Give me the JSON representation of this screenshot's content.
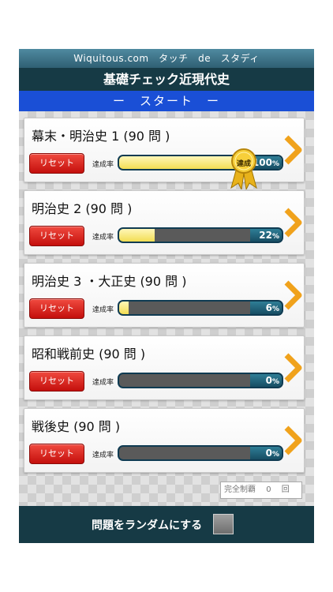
{
  "header": {
    "site": "Wiquitous.com　タッチ　de　スタディ",
    "title": "基礎チェック近現代史"
  },
  "start_label": "ー　スタート　ー",
  "rate_label": "達成率",
  "reset_label": "リセット",
  "percent_unit": "%",
  "medal_label": "達成",
  "items": [
    {
      "title": "幕末・明治史 1 (90 問 )",
      "percent": "100",
      "progress": 1.0
    },
    {
      "title": "明治史 2 (90 問 )",
      "percent": "22",
      "progress": 0.22
    },
    {
      "title": "明治史 3 ・大正史 (90 問 )",
      "percent": "6",
      "progress": 0.06
    },
    {
      "title": "昭和戦前史 (90 問 )",
      "percent": "0",
      "progress": 0.0
    },
    {
      "title": "戦後史 (90 問 )",
      "percent": "0",
      "progress": 0.0
    }
  ],
  "complete_counter": {
    "label": "完全制覇",
    "count": "0",
    "unit": "回"
  },
  "footer": {
    "random_label": "問題をランダムにする",
    "random_checked": false
  },
  "colors": {
    "accent": "#1a4fd6",
    "dark": "#163a45",
    "reset": "#d81f1a",
    "fill": "#f2dd53",
    "chevron": "#f0a21c"
  },
  "icons": {
    "arrow": "chevron-right-icon",
    "medal": "medal-icon"
  }
}
